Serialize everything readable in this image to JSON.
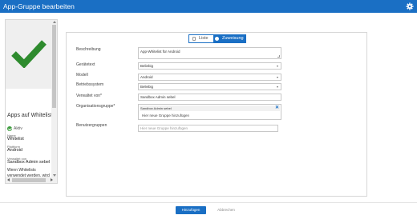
{
  "window": {
    "title": "App-Gruppe bearbeiten",
    "settings_icon": "gear-icon"
  },
  "colors": {
    "accent": "#1a6fc4",
    "check": "#2e8b2e",
    "active": "#3c9b3c"
  },
  "app_card": {
    "icon": "checkmark-icon",
    "name": "Apps auf Whitelist",
    "status": "Aktiv",
    "fields": [
      {
        "label": "Name",
        "value": "Whitelist"
      },
      {
        "label": "Plattform",
        "value": "Android"
      },
      {
        "label": "Verwaltet von",
        "value": "Sandbox Admin sebel"
      }
    ],
    "description": "Wenn Whitelists verwendet werden, wird dadurch gewährleistet, dass nur Apps auf dem Gerät"
  },
  "view_toggle": {
    "list_label": "Liste",
    "assign_label": "Zuweisung",
    "active": "Zuweisung"
  },
  "form": {
    "description": {
      "label": "Beschreibung",
      "value": "App-Whitelist für Android"
    },
    "manufacturer": {
      "label": "Gerätetext",
      "value": "Beliebig"
    },
    "model": {
      "label": "Modell",
      "value": "Android"
    },
    "os": {
      "label": "Betriebssystem",
      "value": "Beliebig"
    },
    "managed_by": {
      "label": "Verwaltet von*",
      "value": "Sandbox Admin sebel"
    },
    "org_group": {
      "label": "Organisationsgruppe*",
      "tag": "Sandbox Admin sebel",
      "add_label": "Hier neue Gruppe hinzufügen"
    },
    "user_groups": {
      "label": "Benutzergruppen",
      "placeholder": "Hier neue Gruppe hinzufügen"
    }
  },
  "footer": {
    "save_label": "Hinzufügen",
    "cancel_label": "Abbrechen"
  }
}
